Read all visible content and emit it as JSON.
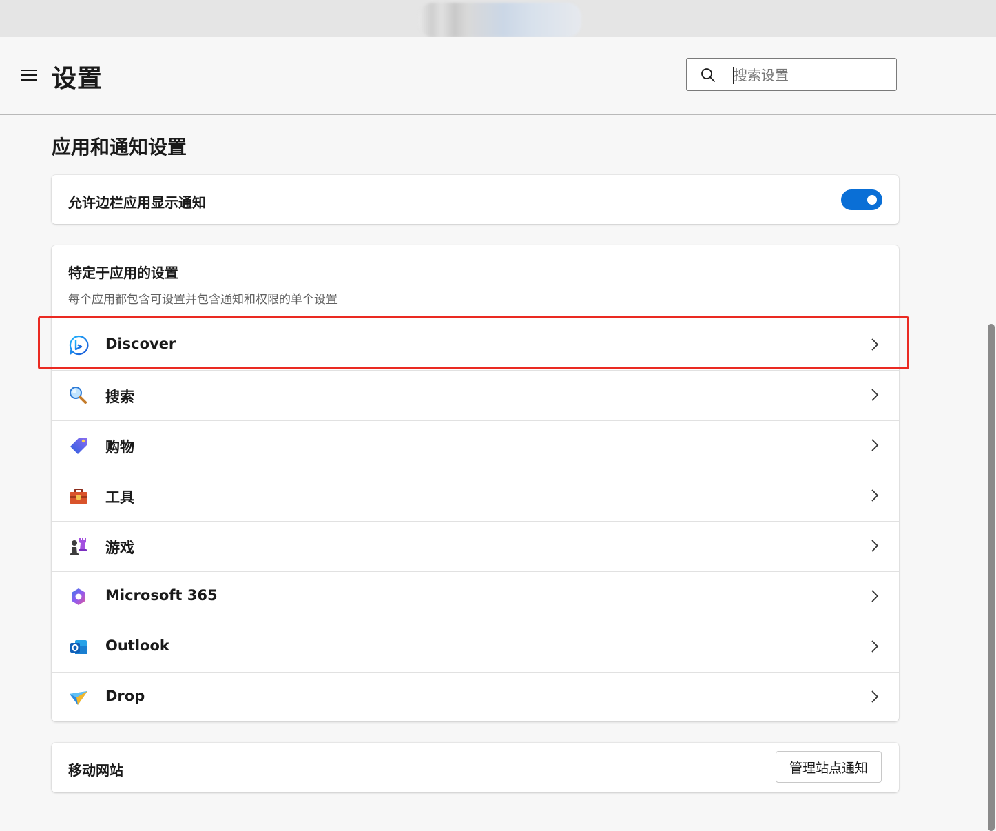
{
  "header": {
    "title": "设置",
    "search_placeholder": "搜索设置",
    "search_value": ""
  },
  "section": {
    "title": "应用和通知设置"
  },
  "sidebar_notifications": {
    "label": "允许边栏应用显示通知",
    "toggle_on": true,
    "toggle_color": "#0a6fd6"
  },
  "app_settings": {
    "heading": "特定于应用的设置",
    "description": "每个应用都包含可设置并包含通知和权限的单个设置",
    "items": [
      {
        "label": "Discover",
        "icon": "bing-icon",
        "highlighted": true
      },
      {
        "label": "搜索",
        "icon": "magnifier-icon"
      },
      {
        "label": "购物",
        "icon": "shopping-tag-icon"
      },
      {
        "label": "工具",
        "icon": "toolbox-icon"
      },
      {
        "label": "游戏",
        "icon": "chess-icon"
      },
      {
        "label": "Microsoft 365",
        "icon": "microsoft-365-icon"
      },
      {
        "label": "Outlook",
        "icon": "outlook-icon"
      },
      {
        "label": "Drop",
        "icon": "drop-icon"
      }
    ]
  },
  "mobile_sites": {
    "label": "移动网站",
    "button_label": "管理站点通知"
  },
  "colors": {
    "accent": "#0a6fd6",
    "highlight_border": "#ea2a22"
  }
}
